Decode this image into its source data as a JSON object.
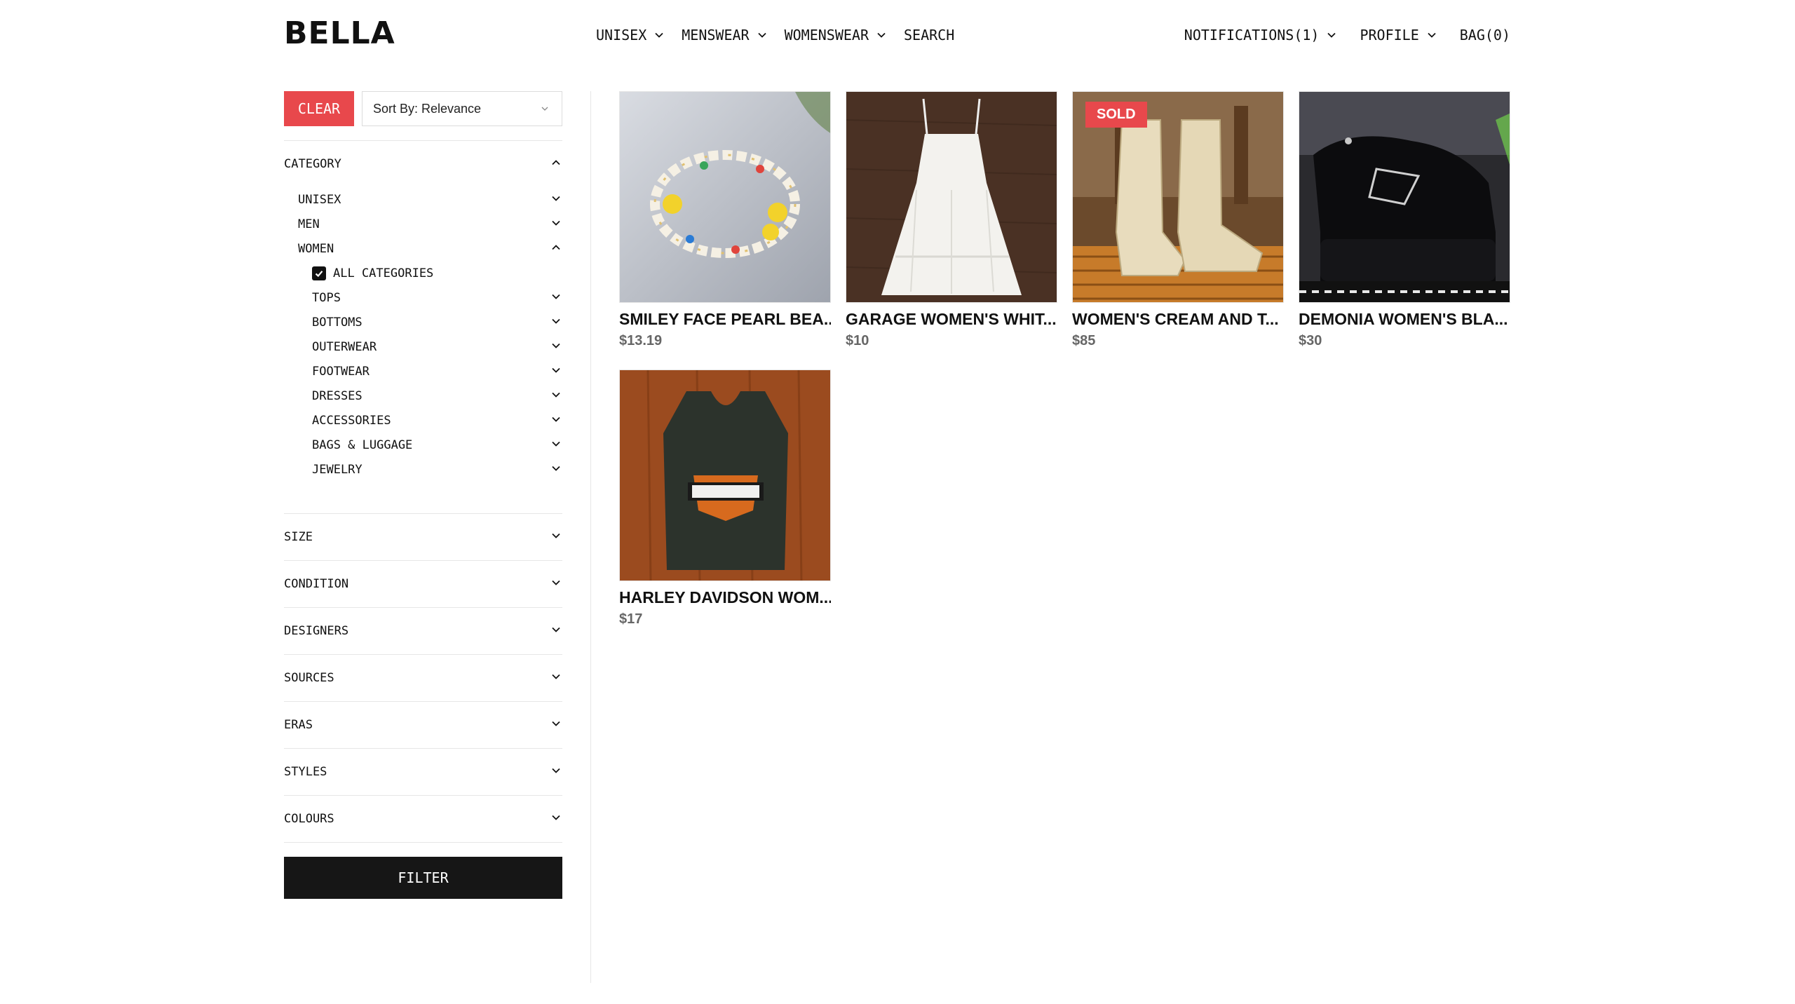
{
  "header": {
    "logo": "BELLA",
    "nav_left": [
      {
        "label": "UNISEX",
        "has_dropdown": true
      },
      {
        "label": "MENSWEAR",
        "has_dropdown": true
      },
      {
        "label": "WOMENSWEAR",
        "has_dropdown": true
      },
      {
        "label": "SEARCH",
        "has_dropdown": false
      }
    ],
    "nav_right": [
      {
        "label": "NOTIFICATIONS(1)",
        "has_dropdown": true
      },
      {
        "label": "PROFILE",
        "has_dropdown": true
      },
      {
        "label": "BAG(0)",
        "has_dropdown": false
      }
    ]
  },
  "sidebar": {
    "clear_label": "CLEAR",
    "sort_label": "Sort By: Relevance",
    "category": {
      "title": "CATEGORY",
      "expanded": true,
      "items": [
        {
          "label": "UNISEX",
          "expanded": false
        },
        {
          "label": "MEN",
          "expanded": false
        },
        {
          "label": "WOMEN",
          "expanded": true
        }
      ],
      "women": {
        "all_categories_label": "ALL CATEGORIES",
        "all_categories_checked": true,
        "subcategories": [
          "TOPS",
          "BOTTOMS",
          "OUTERWEAR",
          "FOOTWEAR",
          "DRESSES",
          "ACCESSORIES",
          "BAGS & LUGGAGE",
          "JEWELRY"
        ]
      }
    },
    "sections": [
      "SIZE",
      "CONDITION",
      "DESIGNERS",
      "SOURCES",
      "ERAS",
      "STYLES",
      "COLOURS"
    ],
    "filter_label": "FILTER"
  },
  "products": [
    {
      "title": "SMILEY FACE PEARL BEA...",
      "price": "$13.19",
      "sold": false,
      "image": "bracelet"
    },
    {
      "title": "GARAGE WOMEN'S WHIT...",
      "price": "$10",
      "sold": false,
      "image": "white-dress"
    },
    {
      "title": "WOMEN'S CREAM AND T...",
      "price": "$85",
      "sold": true,
      "sold_label": "SOLD",
      "image": "cowboy-boots"
    },
    {
      "title": "DEMONIA WOMEN'S BLA...",
      "price": "$30",
      "sold": false,
      "image": "platform-shoes"
    },
    {
      "title": "HARLEY DAVIDSON WOM...",
      "price": "$17",
      "sold": false,
      "image": "leather-vest"
    }
  ],
  "colors": {
    "accent_red": "#e8484c",
    "filter_button_bg": "#161616",
    "price_gray": "#666666"
  }
}
